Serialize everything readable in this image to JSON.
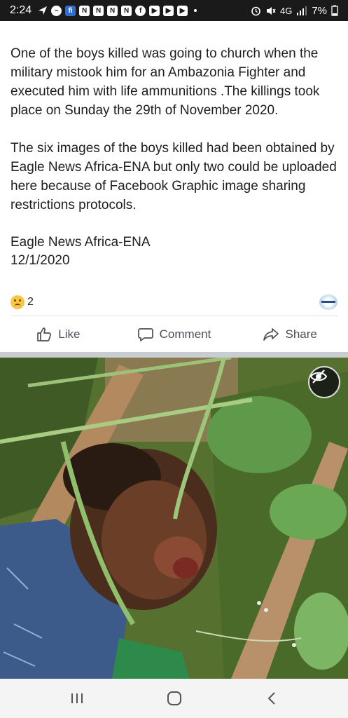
{
  "status_bar": {
    "time": "2:24",
    "network": "4G",
    "battery": "7%"
  },
  "post": {
    "paragraphs": [
      "One of the boys killed was going to church when the military mistook him for an Ambazonia Fighter and executed him with life ammunitions .The killings took place on Sunday the 29th of November 2020.",
      "The six images of the boys killed had been obtained by Eagle News Africa-ENA but only two could be uploaded here because of Facebook Graphic image sharing restrictions protocols."
    ],
    "source_name": "Eagle News Africa-ENA",
    "source_date": "12/1/2020"
  },
  "reactions": {
    "count": "2"
  },
  "actions": {
    "like_label": "Like",
    "comment_label": "Comment",
    "share_label": "Share"
  },
  "colors": {
    "status_bar_bg": "#1a1a1a",
    "text": "#1c1e21",
    "action_text": "#4b4f56",
    "divider": "#dcdfe3"
  }
}
